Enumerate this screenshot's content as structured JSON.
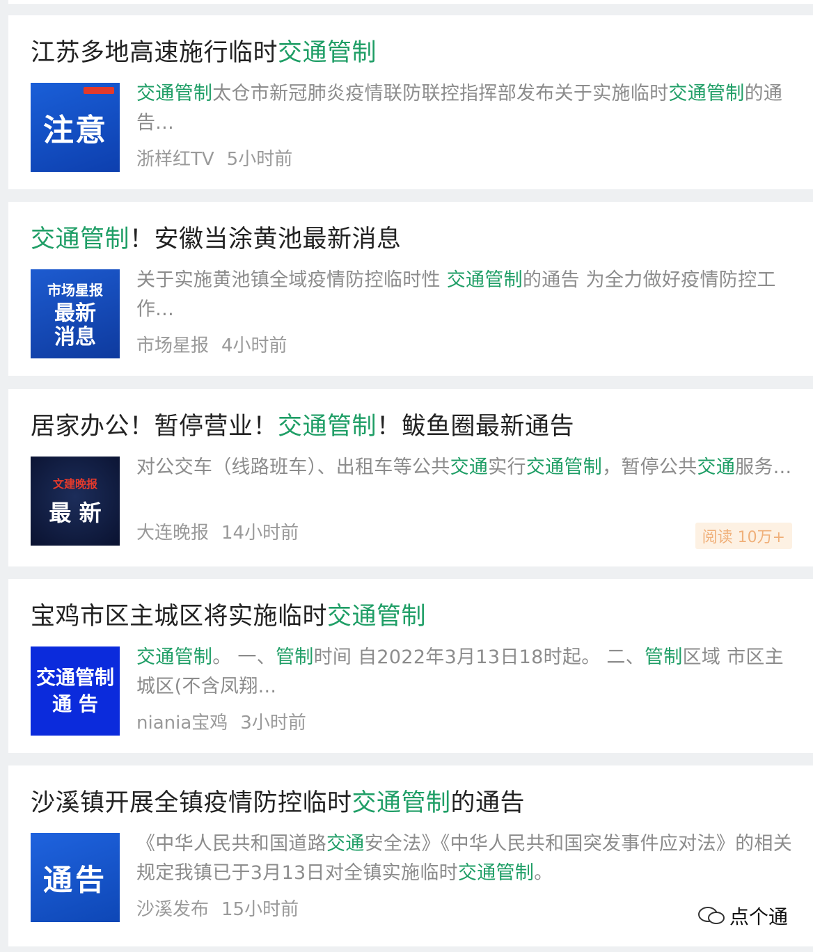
{
  "articles": [
    {
      "title_plain": "江苏多地高速施行临时",
      "title_hl": "交通管制",
      "title_tail": "",
      "thumb_text": "注意",
      "thumb_small": "",
      "snippet_html_parts": [
        {
          "t": "交通管制",
          "hl": true
        },
        {
          "t": "太仓市新冠肺炎疫情联防联控指挥部发布关于实施临时",
          "hl": false
        },
        {
          "t": "交通管制",
          "hl": true
        },
        {
          "t": "的通告...",
          "hl": false
        }
      ],
      "source": "浙样红TV",
      "time": "5小时前",
      "read": ""
    },
    {
      "title_plain": "",
      "title_hl": "交通管制",
      "title_tail": "！安徽当涂黄池最新消息",
      "thumb_text": "最新\n消息",
      "thumb_small": "市场星报",
      "snippet_html_parts": [
        {
          "t": "关于实施黄池镇全域疫情防控临时性 ",
          "hl": false
        },
        {
          "t": "交通管制",
          "hl": true
        },
        {
          "t": "的通告 为全力做好疫情防控工作...",
          "hl": false
        }
      ],
      "source": "市场星报",
      "time": "4小时前",
      "read": ""
    },
    {
      "title_plain": "居家办公！暂停营业！",
      "title_hl": "交通管制",
      "title_tail": "！鲅鱼圈最新通告",
      "thumb_text": "最 新",
      "thumb_small": "文建晚报",
      "snippet_html_parts": [
        {
          "t": "对公交车（线路班车）、出租车等公共",
          "hl": false
        },
        {
          "t": "交通",
          "hl": true
        },
        {
          "t": "实行",
          "hl": false
        },
        {
          "t": "交通管制",
          "hl": true
        },
        {
          "t": "，暂停公共",
          "hl": false
        },
        {
          "t": "交通",
          "hl": true
        },
        {
          "t": "服务...",
          "hl": false
        }
      ],
      "source": "大连晚报",
      "time": "14小时前",
      "read": "阅读 10万+"
    },
    {
      "title_plain": "宝鸡市区主城区将实施临时",
      "title_hl": "交通管制",
      "title_tail": "",
      "thumb_text": "交通管制\n通 告",
      "thumb_small": "",
      "snippet_html_parts": [
        {
          "t": "交通管制",
          "hl": true
        },
        {
          "t": "。 一、",
          "hl": false
        },
        {
          "t": "管制",
          "hl": true
        },
        {
          "t": "时间 自2022年3月13日18时起。 二、",
          "hl": false
        },
        {
          "t": "管制",
          "hl": true
        },
        {
          "t": "区域 市区主城区(不含凤翔...",
          "hl": false
        }
      ],
      "source": "niania宝鸡",
      "time": "3小时前",
      "read": ""
    },
    {
      "title_plain": "沙溪镇开展全镇疫情防控临时",
      "title_hl": "交通管制",
      "title_tail": "的通告",
      "thumb_text": "通告",
      "thumb_small": "",
      "snippet_html_parts": [
        {
          "t": "《中华人民共和国道路",
          "hl": false
        },
        {
          "t": "交通",
          "hl": true
        },
        {
          "t": "安全法》《中华人民共和国突发事件应对法》的相关规定我镇已于3月13日对全镇实施临时",
          "hl": false
        },
        {
          "t": "交通管制",
          "hl": true
        },
        {
          "t": "。",
          "hl": false
        }
      ],
      "source": "沙溪发布",
      "time": "15小时前",
      "read": ""
    }
  ],
  "watermark": "点个通",
  "colors": {
    "highlight": "#1f9e66",
    "title": "#222222",
    "snippet": "#8c8c8c",
    "meta": "#9a9a9a",
    "background": "#eef0f2"
  }
}
